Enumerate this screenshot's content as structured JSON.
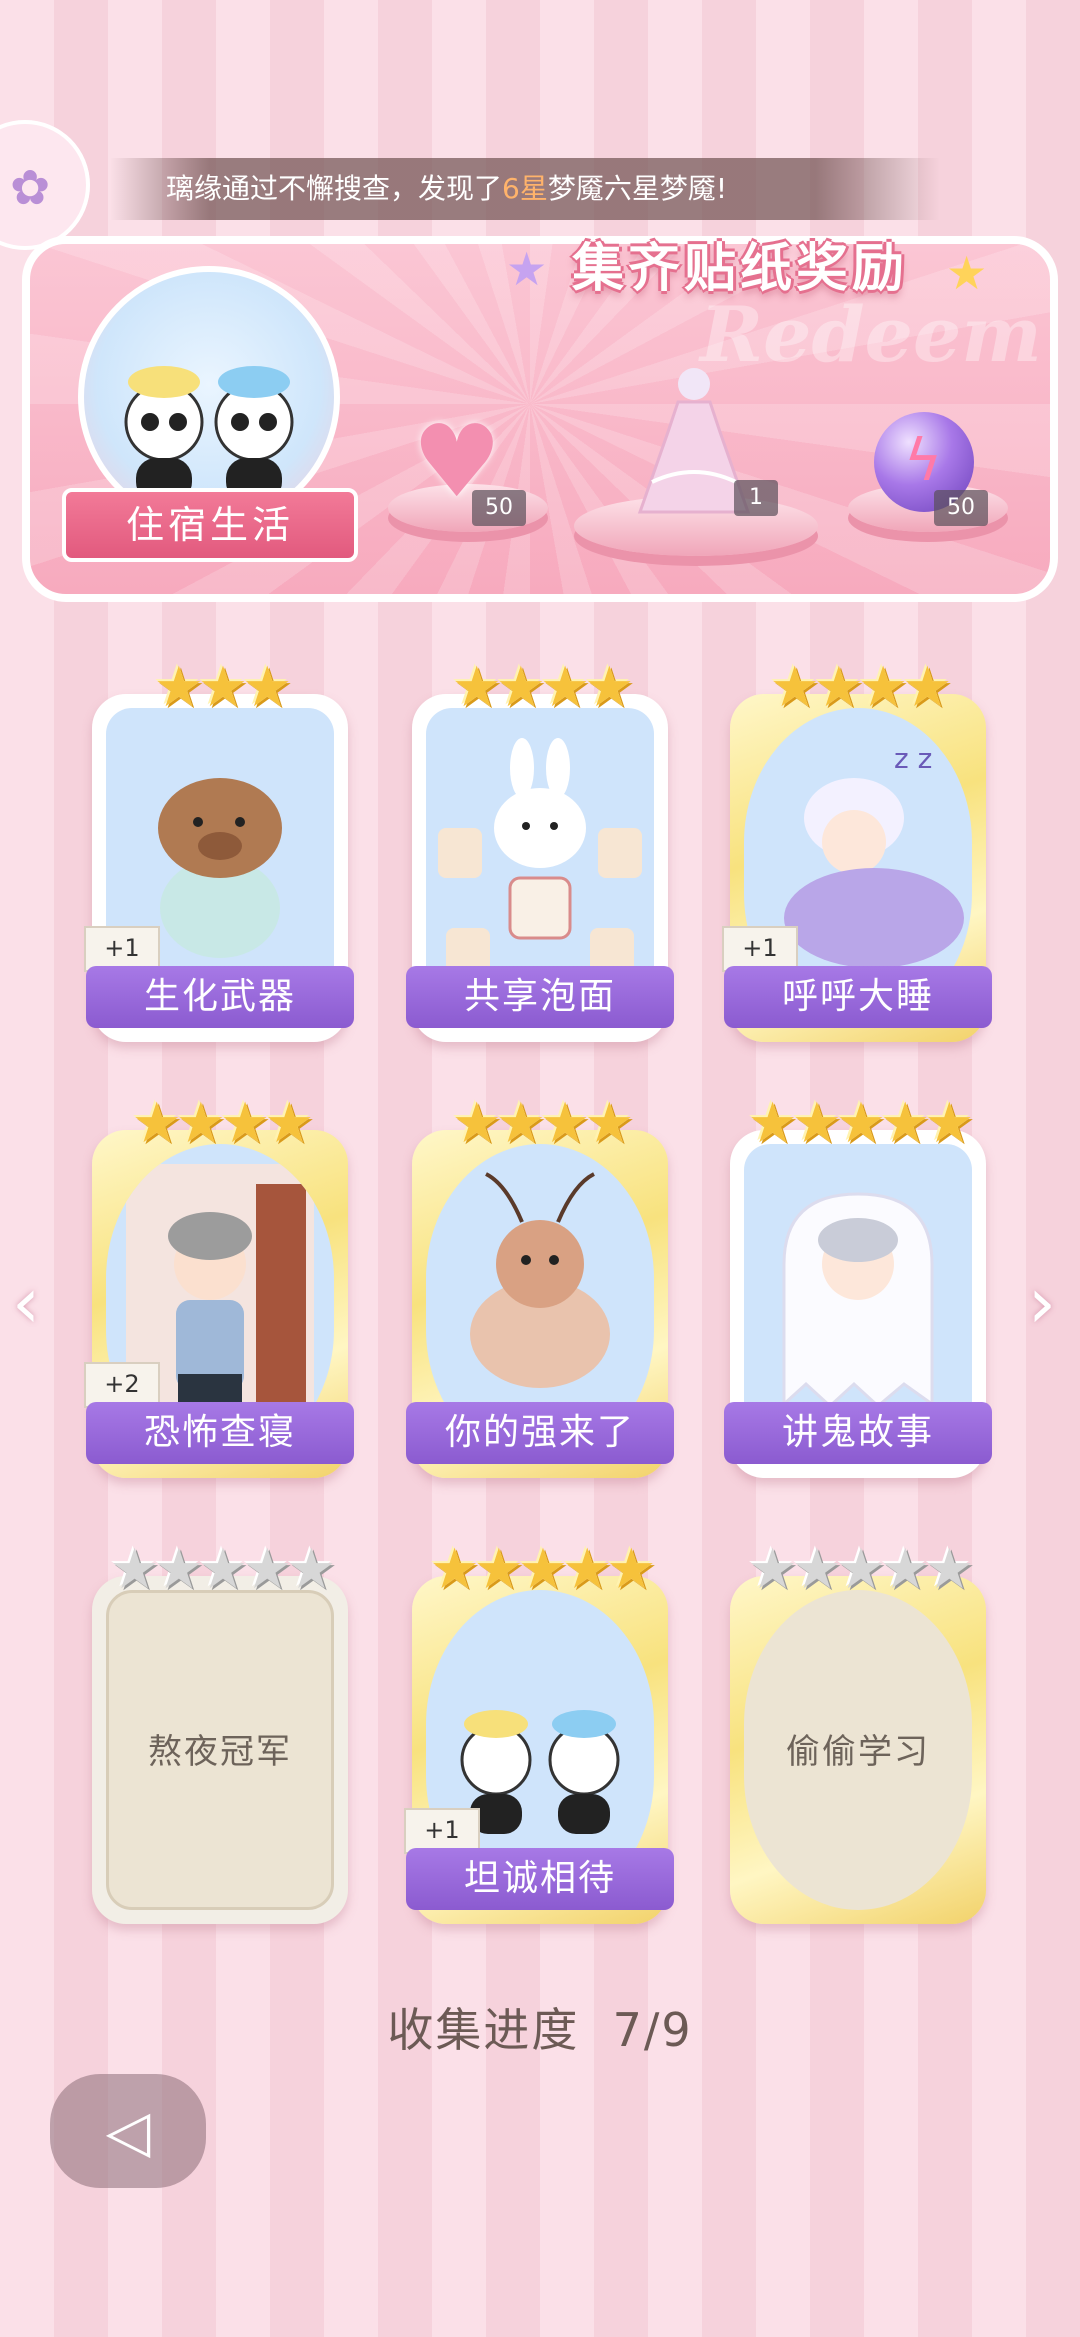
{
  "announcement": {
    "prefix": "璃缘通过不懈搜查，发现了",
    "highlight": "6星",
    "suffix": "梦魇六星梦魇!"
  },
  "reward_panel": {
    "title": "集齐贴纸奖励",
    "background_text": "Redeem",
    "set_name": "住宿生活",
    "rewards": [
      {
        "name": "heart-gem",
        "quantity": "50"
      },
      {
        "name": "dress-outfit",
        "quantity": "1"
      },
      {
        "name": "purple-orb",
        "quantity": "50"
      }
    ]
  },
  "stickers": [
    {
      "label": "生化武器",
      "stars": "★★★",
      "badge": "+1",
      "status": "collected"
    },
    {
      "label": "共享泡面",
      "stars": "★★★★",
      "badge": "",
      "status": "collected"
    },
    {
      "label": "呼呼大睡",
      "stars": "★★★★",
      "badge": "+1",
      "status": "collected"
    },
    {
      "label": "恐怖查寝",
      "stars": "★★★★",
      "badge": "+2",
      "status": "collected"
    },
    {
      "label": "你的强来了",
      "stars": "★★★★",
      "badge": "",
      "status": "collected"
    },
    {
      "label": "讲鬼故事",
      "stars": "★★★★★",
      "badge": "",
      "status": "collected"
    },
    {
      "label": "熬夜冠军",
      "stars": "★★★★★",
      "badge": "",
      "status": "locked"
    },
    {
      "label": "坦诚相待",
      "stars": "★★★★★",
      "badge": "+1",
      "status": "collected"
    },
    {
      "label": "偷偷学习",
      "stars": "★★★★★",
      "badge": "",
      "status": "locked"
    }
  ],
  "progress": {
    "label": "收集进度",
    "value": "7/9"
  },
  "nav": {
    "prev": "‹",
    "next": "›",
    "back": "◁"
  },
  "colors": {
    "accent_pink": "#e25a7e",
    "label_purple": "#8b5bd0",
    "star_gold": "#f6c23b"
  }
}
